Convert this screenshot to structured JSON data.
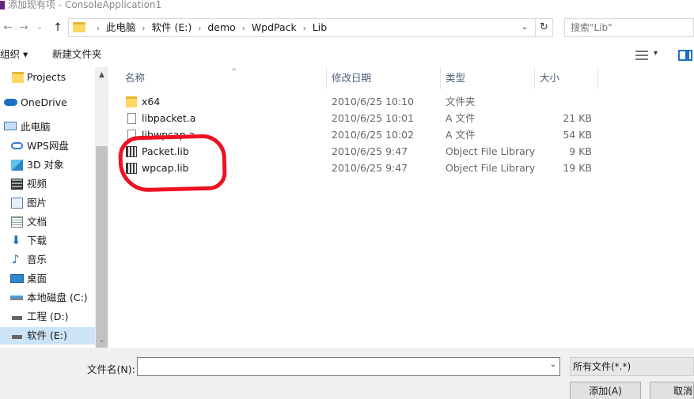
{
  "window": {
    "title": "添加现有项 - ConsoleApplication1"
  },
  "address": {
    "crumbs": [
      "此电脑",
      "软件 (E:)",
      "demo",
      "WpdPack",
      "Lib"
    ],
    "separator": "›",
    "dropdown_glyph": "⌄",
    "refresh_glyph": "↻"
  },
  "nav_buttons": {
    "back": "←",
    "forward": "→",
    "recent": "⌄",
    "up": "↑"
  },
  "search": {
    "placeholder": "搜索\"Lib\""
  },
  "toolbar": {
    "organize": "组织 ▾",
    "new_folder": "新建文件夹",
    "view_dropdown": "▾"
  },
  "sidebar": {
    "items": [
      {
        "label": "Projects",
        "icon": "folder-icon"
      },
      {
        "label": "OneDrive",
        "icon": "cloud-icon"
      },
      {
        "label": "此电脑",
        "icon": "computer-icon"
      },
      {
        "label": "WPS网盘",
        "icon": "cloud-icon"
      },
      {
        "label": "3D 对象",
        "icon": "cube-icon"
      },
      {
        "label": "视频",
        "icon": "video-icon"
      },
      {
        "label": "图片",
        "icon": "picture-icon"
      },
      {
        "label": "文档",
        "icon": "document-icon"
      },
      {
        "label": "下载",
        "icon": "download-icon"
      },
      {
        "label": "音乐",
        "icon": "music-icon"
      },
      {
        "label": "桌面",
        "icon": "desktop-icon"
      },
      {
        "label": "本地磁盘 (C:)",
        "icon": "drive-icon"
      },
      {
        "label": "工程 (D:)",
        "icon": "drive-icon"
      },
      {
        "label": "软件 (E:)",
        "icon": "drive-icon",
        "selected": true
      }
    ],
    "scroll_up": "▲",
    "scroll_down": "⌄"
  },
  "columns": {
    "name": "名称",
    "date": "修改日期",
    "type": "类型",
    "size": "大小",
    "sort_indicator": "^"
  },
  "files": [
    {
      "name": "x64",
      "date": "2010/6/25 10:10",
      "type": "文件夹",
      "size": "",
      "icon": "folder-icon"
    },
    {
      "name": "libpacket.a",
      "date": "2010/6/25 10:01",
      "type": "A 文件",
      "size": "21 KB",
      "icon": "file-icon"
    },
    {
      "name": "libwpcap.a",
      "date": "2010/6/25 10:02",
      "type": "A 文件",
      "size": "54 KB",
      "icon": "file-icon"
    },
    {
      "name": "Packet.lib",
      "date": "2010/6/25 9:47",
      "type": "Object File Library",
      "size": "9 KB",
      "icon": "library-icon"
    },
    {
      "name": "wpcap.lib",
      "date": "2010/6/25 9:47",
      "type": "Object File Library",
      "size": "19 KB",
      "icon": "library-icon"
    }
  ],
  "bottom": {
    "filename_label": "文件名(N):",
    "filename_value": "",
    "filename_dropdown": "⌄",
    "filetype": "所有文件(*.*)",
    "add_button": "添加(A)",
    "cancel_button": "取消"
  },
  "colors": {
    "selection": "#cce4f7",
    "annotation": "#ee1122",
    "accent": "#1e6fc4"
  }
}
